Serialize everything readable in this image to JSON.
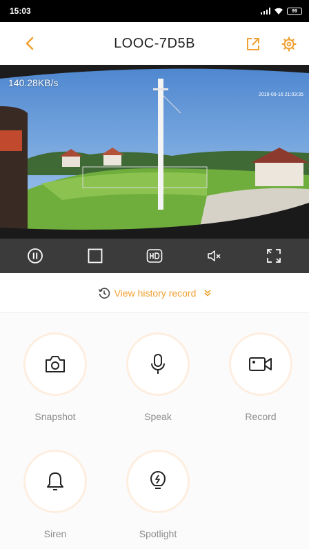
{
  "status_bar": {
    "time": "15:03",
    "battery": "99"
  },
  "header": {
    "title": "LOOC-7D5B"
  },
  "video": {
    "bitrate": "140.28KB/s",
    "timestamp": "2019-09-16 21:03:35"
  },
  "controls": [
    "pause-icon",
    "stop-icon",
    "hd-icon",
    "mute-icon",
    "fullscreen-icon"
  ],
  "history": {
    "label": "View history record"
  },
  "actions": [
    {
      "label": "Snapshot",
      "icon": "camera-icon"
    },
    {
      "label": "Speak",
      "icon": "microphone-icon"
    },
    {
      "label": "Record",
      "icon": "video-record-icon"
    },
    {
      "label": "Siren",
      "icon": "bell-icon"
    },
    {
      "label": "Spotlight",
      "icon": "bulb-icon"
    }
  ],
  "colors": {
    "accent": "#f0a030",
    "control_bar": "#3b3b3b",
    "ring": "#fdeee0"
  }
}
